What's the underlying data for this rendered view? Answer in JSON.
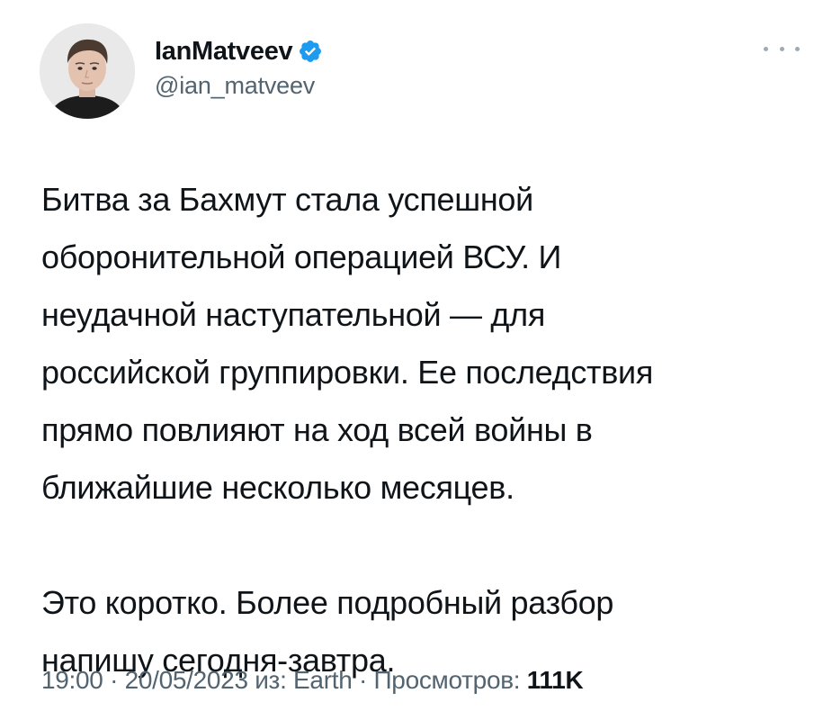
{
  "author": {
    "display_name": "IanMatveev",
    "handle": "@ian_matveev",
    "verified": true,
    "verified_color": "#1d9bf0"
  },
  "tweet": {
    "paragraphs": [
      "Битва за Бахмут стала успешной\nоборонительной операцией ВСУ. И\nнеудачной наступательной — для\nроссийской группировки. Ее последствия\nпрямо повлияют на ход всей войны в\nближайшие несколько месяцев.",
      "Это коротко. Более подробный разбор\nнапишу сегодня-завтра."
    ]
  },
  "meta": {
    "time": "19:00",
    "separator": "·",
    "date": "20/05/2023",
    "source": "из: Earth",
    "views_label": "Просмотров:",
    "views_count": "111K"
  },
  "icons": {
    "more": "more-icon",
    "verified": "verified-badge-icon"
  }
}
